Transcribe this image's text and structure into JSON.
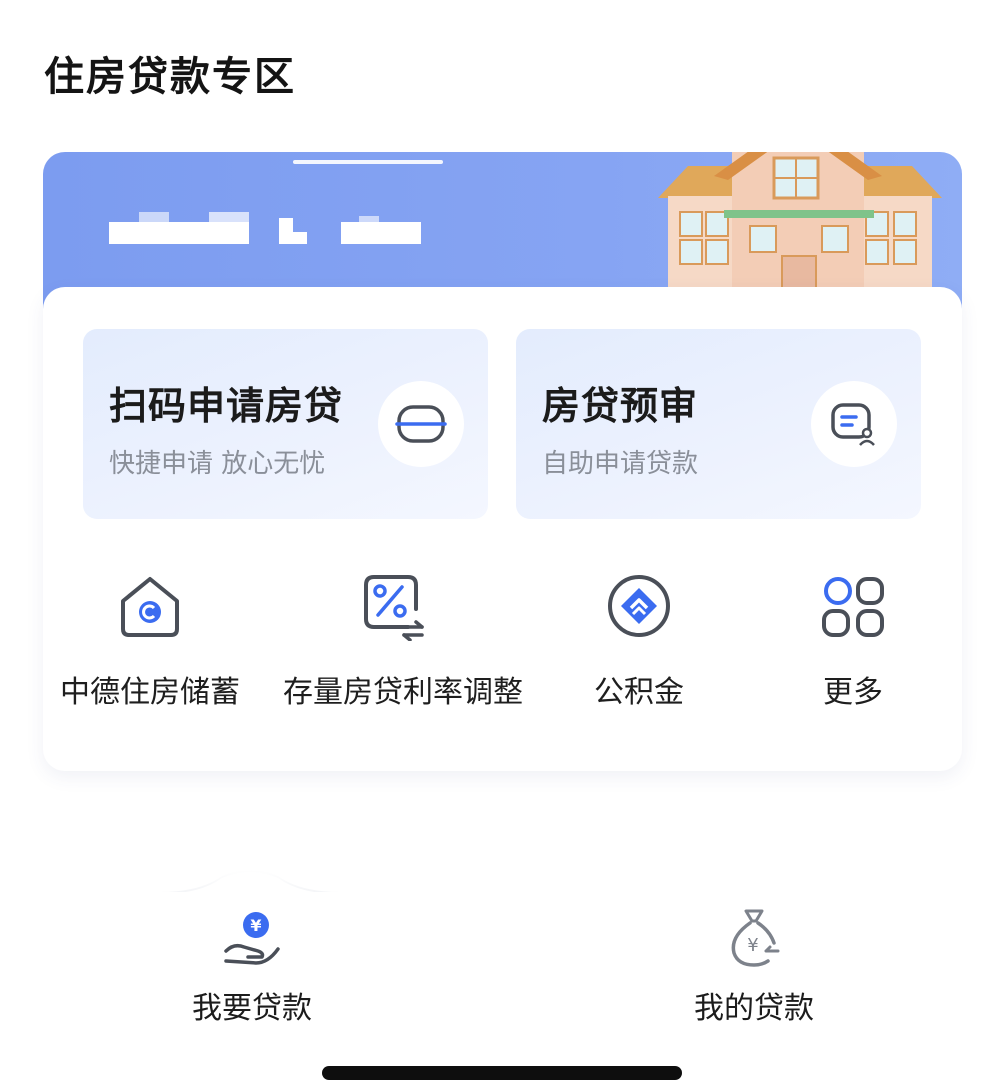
{
  "page": {
    "title": "住房贷款专区"
  },
  "colors": {
    "accent": "#3b6cf0",
    "banner": "#7c9cf0",
    "icon_gray": "#5a5e66"
  },
  "feature_cards": [
    {
      "title": "扫码申请房贷",
      "subtitle": "快捷申请 放心无忧",
      "icon": "scan-icon"
    },
    {
      "title": "房贷预审",
      "subtitle": "自助申请贷款",
      "icon": "document-user-icon"
    }
  ],
  "quick_links": [
    {
      "label": "中德住房储蓄",
      "icon": "house-c-icon"
    },
    {
      "label": "存量房贷利率调整",
      "icon": "percent-exchange-icon"
    },
    {
      "label": "公积金",
      "icon": "diamond-arrows-icon"
    },
    {
      "label": "更多",
      "icon": "more-grid-icon"
    }
  ],
  "tabs": [
    {
      "label": "我要贷款",
      "icon": "hand-coin-icon"
    },
    {
      "label": "我的贷款",
      "icon": "money-bag-icon"
    }
  ]
}
